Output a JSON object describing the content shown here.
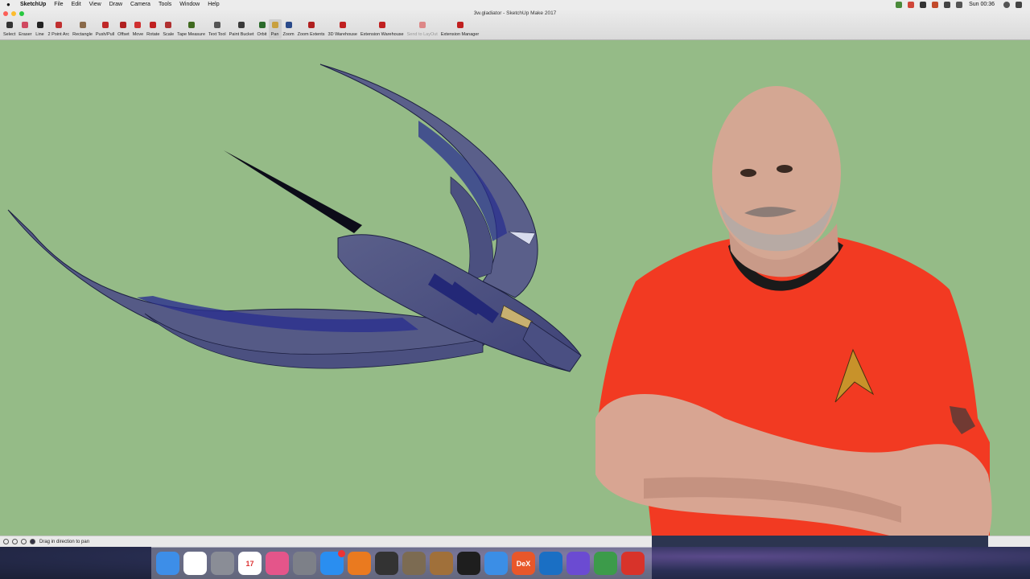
{
  "menubar": {
    "app_name": "SketchUp",
    "items": [
      "File",
      "Edit",
      "View",
      "Draw",
      "Camera",
      "Tools",
      "Window",
      "Help"
    ],
    "clock": "Sun 00:36"
  },
  "window": {
    "title": "3w.gladiator - SketchUp Make 2017"
  },
  "toolbar": {
    "tools": [
      {
        "label": "Select",
        "icon": "select-icon"
      },
      {
        "label": "Eraser",
        "icon": "eraser-icon"
      },
      {
        "label": "Line",
        "icon": "line-icon"
      },
      {
        "label": "2 Point Arc",
        "icon": "arc-icon"
      },
      {
        "label": "Rectangle",
        "icon": "rectangle-icon"
      },
      {
        "label": "Push/Pull",
        "icon": "pushpull-icon"
      },
      {
        "label": "Offset",
        "icon": "offset-icon"
      },
      {
        "label": "Move",
        "icon": "move-icon"
      },
      {
        "label": "Rotate",
        "icon": "rotate-icon"
      },
      {
        "label": "Scale",
        "icon": "scale-icon"
      },
      {
        "label": "Tape Measure",
        "icon": "tape-measure-icon"
      },
      {
        "label": "Text Tool",
        "icon": "text-tool-icon"
      },
      {
        "label": "Paint Bucket",
        "icon": "paint-bucket-icon"
      },
      {
        "label": "Orbit",
        "icon": "orbit-icon"
      },
      {
        "label": "Pan",
        "icon": "pan-icon"
      },
      {
        "label": "Zoom",
        "icon": "zoom-icon"
      },
      {
        "label": "Zoom Extents",
        "icon": "zoom-extents-icon"
      },
      {
        "label": "3D Warehouse",
        "icon": "3d-warehouse-icon"
      },
      {
        "label": "Extension Warehouse",
        "icon": "extension-warehouse-icon"
      },
      {
        "label": "Send to LayOut",
        "icon": "send-to-layout-icon"
      },
      {
        "label": "Extension Manager",
        "icon": "extension-manager-icon"
      }
    ],
    "active_tool": "Pan",
    "disabled_tool": "Send to LayOut"
  },
  "statusbar": {
    "text": "Drag in direction to pan"
  },
  "dock": {
    "apps": [
      {
        "name": "finder-icon",
        "color": "#3d8ee8"
      },
      {
        "name": "chrome-icon",
        "color": "#ffffff"
      },
      {
        "name": "launchpad-icon",
        "color": "#8a8d96"
      },
      {
        "name": "calendar-icon",
        "color": "#ffffff",
        "text": "17"
      },
      {
        "name": "itunes-icon",
        "color": "#e4558a"
      },
      {
        "name": "system-preferences-icon",
        "color": "#7d8088"
      },
      {
        "name": "app-store-icon",
        "color": "#2a8ef0"
      },
      {
        "name": "blender-icon",
        "color": "#ea7a1f"
      },
      {
        "name": "tablet-icon",
        "color": "#333333"
      },
      {
        "name": "gimp-icon",
        "color": "#7c6b52"
      },
      {
        "name": "guitar-icon",
        "color": "#a0703a"
      },
      {
        "name": "inkscape-icon",
        "color": "#1e1e1e"
      },
      {
        "name": "mail-icon",
        "color": "#3b8ee6"
      },
      {
        "name": "dex-icon",
        "color": "#e8572a",
        "text": "DeX"
      },
      {
        "name": "quicktime-icon",
        "color": "#1a6fc4"
      },
      {
        "name": "imovie-icon",
        "color": "#6b4bd2"
      },
      {
        "name": "headphones-icon",
        "color": "#3c9b4a"
      },
      {
        "name": "sketchup-icon",
        "color": "#d8332a"
      }
    ]
  }
}
